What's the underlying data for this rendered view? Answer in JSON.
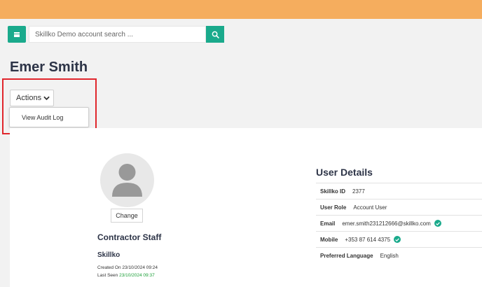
{
  "header": {
    "accent_color": "#f5ad5e"
  },
  "toolbar": {
    "menu_icon": "menu-icon",
    "search_placeholder": "Skillko Demo account search ...",
    "search_icon": "search-icon"
  },
  "page": {
    "title": "Emer Smith"
  },
  "actions": {
    "label": "Actions",
    "caret_icon": "chevron-down-icon",
    "menu_items": [
      {
        "label": "View Audit Log"
      }
    ]
  },
  "profile": {
    "avatar_icon": "user-icon",
    "change_label": "Change",
    "role": "Contractor Staff",
    "company": "Skillko",
    "created_on": "Created On 23/10/2024 09:24",
    "last_seen_label": "Last Seen",
    "last_seen_value": "23/10/2024 09:37"
  },
  "user_details": {
    "title": "User Details",
    "rows": [
      {
        "label": "Skillko ID",
        "value": "2377"
      },
      {
        "label": "User Role",
        "value": "Account User"
      },
      {
        "label": "Email",
        "value": "emer.smith231212666@skillko.com",
        "verified": true
      },
      {
        "label": "Mobile",
        "value": "+353 87 614 4375",
        "verified": true
      },
      {
        "label": "Preferred Language",
        "value": "English"
      }
    ]
  },
  "colors": {
    "brand": "#1aaa8c",
    "highlight": "#e0262c",
    "title": "#2d3447",
    "last_seen": "#1a9e36"
  }
}
